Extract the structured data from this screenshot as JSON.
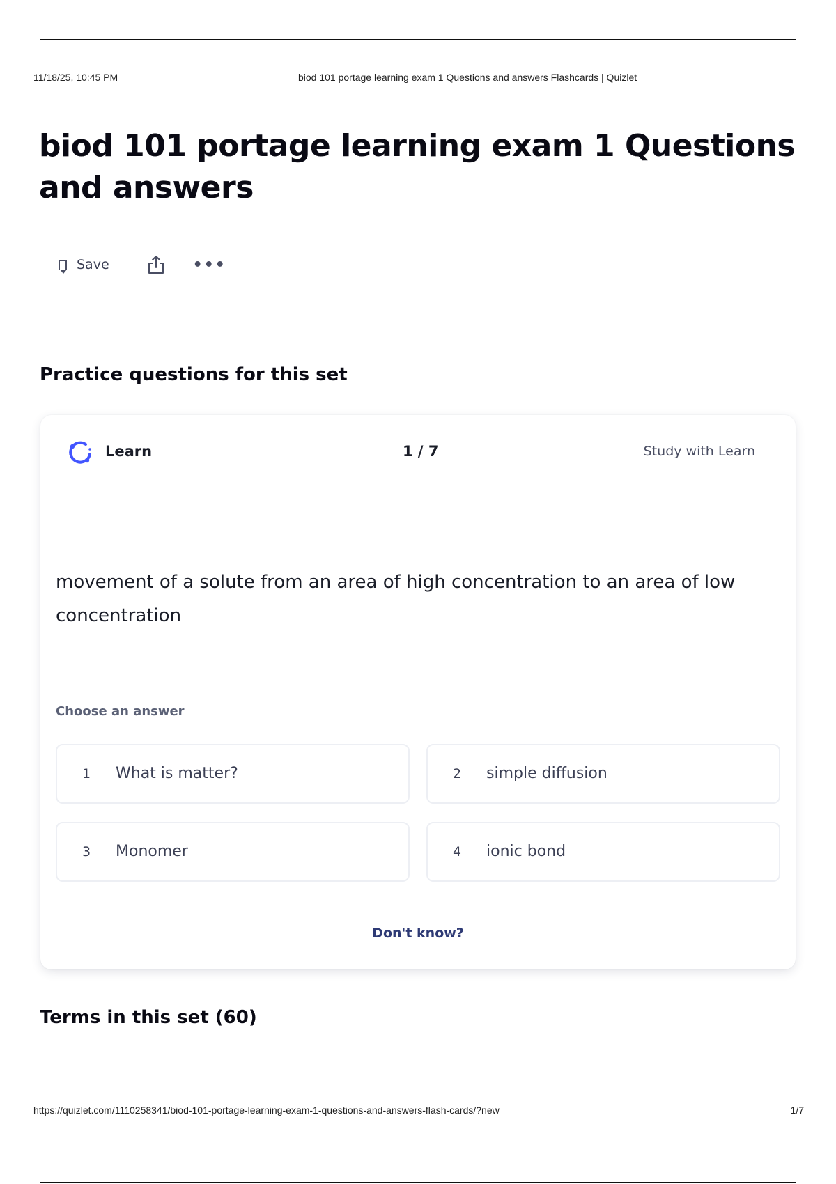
{
  "print_header": {
    "datetime": "11/18/25, 10:45 PM",
    "document_title": "biod 101 portage learning exam 1 Questions and answers Flashcards | Quizlet"
  },
  "set": {
    "title": "biod 101 portage learning exam 1 Questions and answers"
  },
  "actions": {
    "save_label": "Save",
    "save_icon": "bookmark-icon",
    "share_icon": "share-icon",
    "more_label": "•••",
    "more_icon": "more-options-icon"
  },
  "practice": {
    "heading": "Practice questions for this set",
    "mode_label": "Learn",
    "mode_icon": "learn-mode-icon",
    "accent_color": "#4255ff",
    "progress": "1 / 7",
    "study_link": "Study with Learn",
    "prompt": "movement of a solute from an area of high concentration to an area of low concentration",
    "choose_label": "Choose an answer",
    "options": [
      {
        "number": "1",
        "text": "What is matter?"
      },
      {
        "number": "2",
        "text": "simple diffusion"
      },
      {
        "number": "3",
        "text": "Monomer"
      },
      {
        "number": "4",
        "text": "ionic bond"
      }
    ],
    "dont_know": "Don't know?"
  },
  "terms": {
    "heading": "Terms in this set (60)"
  },
  "print_footer": {
    "url": "https://quizlet.com/1110258341/biod-101-portage-learning-exam-1-questions-and-answers-flash-cards/?new",
    "page": "1/7"
  }
}
